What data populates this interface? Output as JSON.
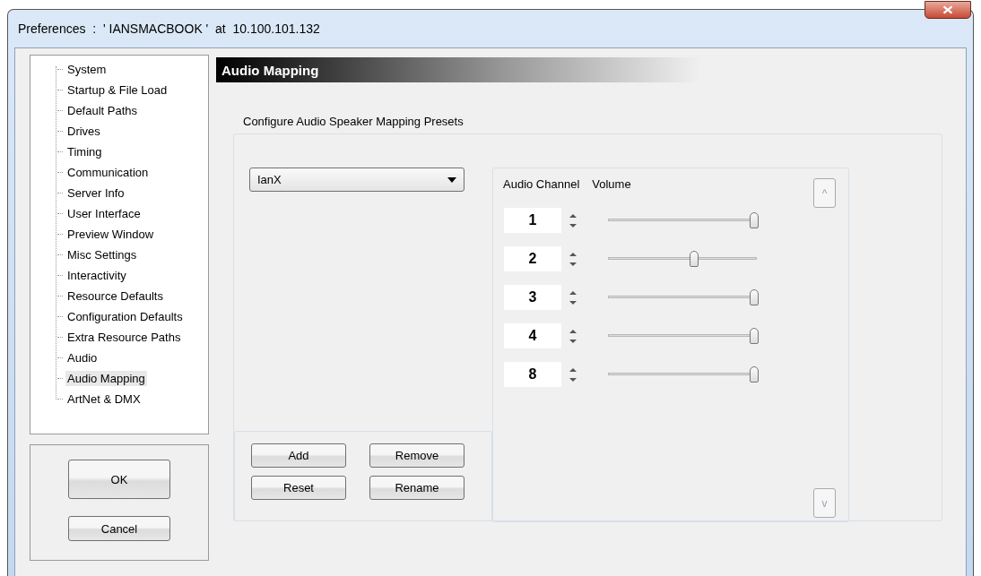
{
  "window": {
    "title": "Preferences  :  ' IANSMACBOOK '  at  10.100.101.132"
  },
  "sidebar": {
    "items": [
      {
        "label": "System",
        "selected": false
      },
      {
        "label": "Startup & File Load",
        "selected": false
      },
      {
        "label": "Default Paths",
        "selected": false
      },
      {
        "label": "Drives",
        "selected": false
      },
      {
        "label": "Timing",
        "selected": false
      },
      {
        "label": "Communication",
        "selected": false
      },
      {
        "label": "Server Info",
        "selected": false
      },
      {
        "label": "User Interface",
        "selected": false
      },
      {
        "label": "Preview Window",
        "selected": false
      },
      {
        "label": "Misc Settings",
        "selected": false
      },
      {
        "label": "Interactivity",
        "selected": false
      },
      {
        "label": "Resource Defaults",
        "selected": false
      },
      {
        "label": "Configuration Defaults",
        "selected": false
      },
      {
        "label": "Extra Resource Paths",
        "selected": false
      },
      {
        "label": "Audio",
        "selected": false
      },
      {
        "label": "Audio Mapping",
        "selected": true
      },
      {
        "label": "ArtNet & DMX",
        "selected": false
      }
    ]
  },
  "dialog_buttons": [
    "OK",
    "Cancel"
  ],
  "header": "Audio Mapping",
  "group": {
    "title": "Configure Audio Speaker Mapping Presets",
    "preset_dropdown": {
      "value": "IanX"
    },
    "preset_buttons": [
      "Add",
      "Remove",
      "Reset",
      "Rename"
    ],
    "columns": [
      "Audio Channel",
      "Volume"
    ],
    "channels": [
      {
        "channel": "1",
        "level": 1.0
      },
      {
        "channel": "2",
        "level": 0.58
      },
      {
        "channel": "3",
        "level": 1.0
      },
      {
        "channel": "4",
        "level": 1.0
      },
      {
        "channel": "8",
        "level": 1.0
      }
    ],
    "scroll_up": {
      "label": "^",
      "disabled": true
    },
    "scroll_down": {
      "label": "v",
      "disabled": true
    }
  }
}
